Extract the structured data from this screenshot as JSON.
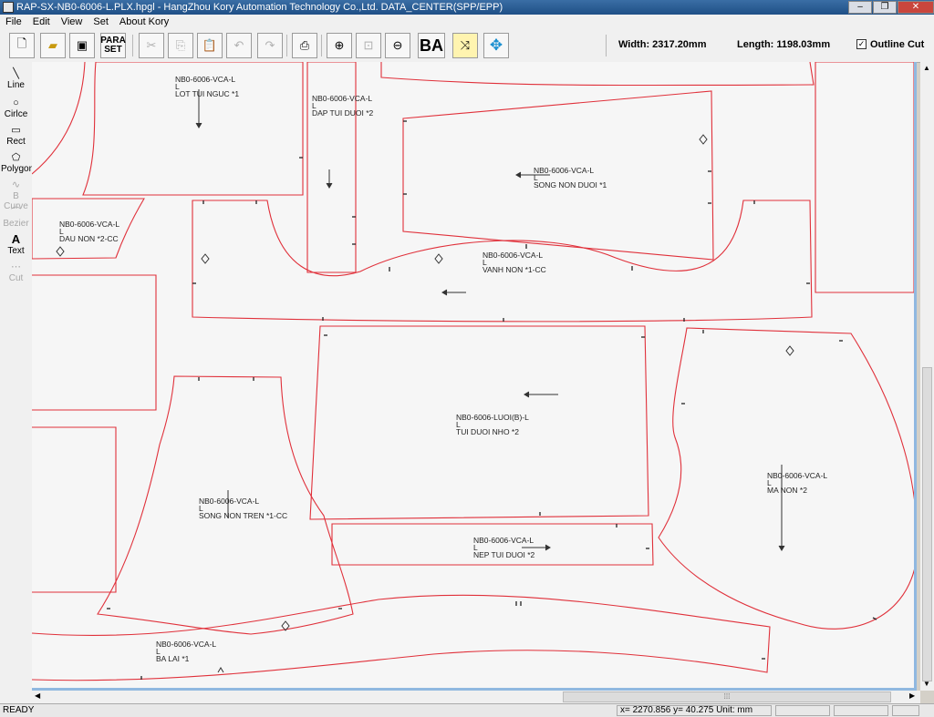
{
  "window": {
    "title": "RAP-SX-NB0-6006-L.PLX.hpgl - HangZhou Kory Automation Technology Co.,Ltd. DATA_CENTER(SPP/EPP)",
    "min_label": "–",
    "max_label": "❐",
    "close_label": "✕"
  },
  "menu": [
    "File",
    "Edit",
    "View",
    "Set",
    "About Kory"
  ],
  "toolbar": {
    "para_set_top": "PARA",
    "para_set_bottom": "SET",
    "ba_label": "BA",
    "width_text": "Width: 2317.20mm",
    "length_text": "Length: 1198.03mm",
    "outline_cut_label": "Outline Cut",
    "outline_cut_checked": true
  },
  "tools": [
    {
      "label": "Line",
      "icon": "line-icon",
      "enabled": true
    },
    {
      "label": "Cirlce",
      "icon": "circle-icon",
      "enabled": true
    },
    {
      "label": "Rect",
      "icon": "rect-icon",
      "enabled": true
    },
    {
      "label": "Polygon",
      "icon": "polygon-icon",
      "enabled": true
    },
    {
      "label": "B Curve",
      "icon": "bcurve-icon",
      "enabled": false
    },
    {
      "label": "Bezier",
      "icon": "bezier-icon",
      "enabled": false
    },
    {
      "label": "Text",
      "icon": "text-icon",
      "enabled": true
    },
    {
      "label": "Cut",
      "icon": "cut-icon",
      "enabled": false
    }
  ],
  "pieces": [
    {
      "line1": "NB0-6006-VCA-L",
      "line2": "L",
      "line3": "LOT TUI NGUC *1"
    },
    {
      "line1": "NB0-6006-VCA-L",
      "line2": "L",
      "line3": "DAP TUI DUOI *2"
    },
    {
      "line1": "NB0-6006-VCA-L",
      "line2": "L",
      "line3": "SONG NON DUOI *1"
    },
    {
      "line1": "NB0-6006-VCA-L",
      "line2": "L",
      "line3": "DAU NON *2-CC"
    },
    {
      "line1": "NB0-6006-VCA-L",
      "line2": "L",
      "line3": "VANH NON *1-CC"
    },
    {
      "line1": "NB0-6006-LUOI(B)-L",
      "line2": "L",
      "line3": "TUI DUOI NHO *2"
    },
    {
      "line1": "NB0-6006-VCA-L",
      "line2": "L",
      "line3": "MA NON *2"
    },
    {
      "line1": "NB0-6006-VCA-L",
      "line2": "L",
      "line3": "SONG NON TREN *1-CC"
    },
    {
      "line1": "NB0-6006-VCA-L",
      "line2": "L",
      "line3": "NEP TUI DUOI *2"
    },
    {
      "line1": "NB0-6006-VCA-L",
      "line2": "L",
      "line3": "BA LAI *1"
    }
  ],
  "status": {
    "ready": "READY",
    "coords": "x= 2270.856  y=   40.275   Unit: mm"
  },
  "colors": {
    "outline": "#e0303a",
    "canvas": "#f6f6f6",
    "canvas_border": "#90b8e0"
  }
}
